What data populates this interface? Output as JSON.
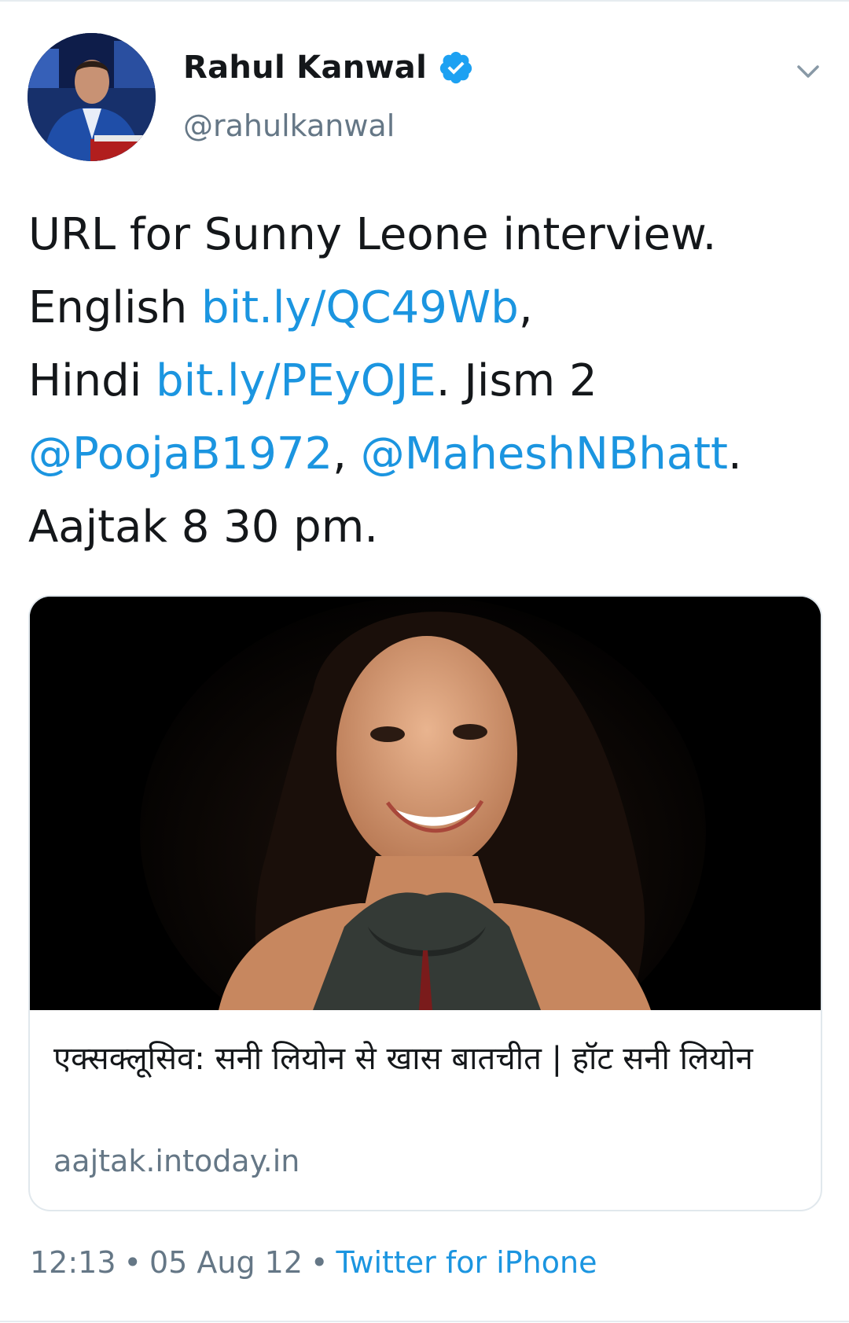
{
  "tweet": {
    "author": {
      "display_name": "Rahul Kanwal",
      "handle": "@rahulkanwal",
      "verified": true,
      "avatar": "avatar-photo"
    },
    "text": {
      "line1": "URL for Sunny Leone interview.",
      "english_prefix": "English ",
      "english_link": "bit.ly/QC49Wb",
      "english_suffix": ",",
      "hindi_prefix": "Hindi ",
      "hindi_link": "bit.ly/PEyOJE",
      "hindi_suffix": ". Jism 2",
      "mention1": "@PoojaB1972",
      "mention_sep": ", ",
      "mention2": "@MaheshNBhatt",
      "mention_suffix": ".",
      "line5": "Aajtak 8 30 pm."
    },
    "card": {
      "image": "interview-photo",
      "title": "एक्सक्लूसिव: सनी लियोन से खास बातचीत | हॉट सनी लियोन",
      "domain": "aajtak.intoday.in"
    },
    "meta": {
      "time": "12:13",
      "separator": "•",
      "date": "05 Aug 12",
      "source": "Twitter for iPhone"
    },
    "icons": {
      "verified": "verified-badge-icon",
      "caret": "chevron-down-icon"
    },
    "colors": {
      "link": "#1b95e0",
      "secondary_text": "#657786",
      "primary_text": "#14171a",
      "border": "#e1e8ed"
    }
  }
}
